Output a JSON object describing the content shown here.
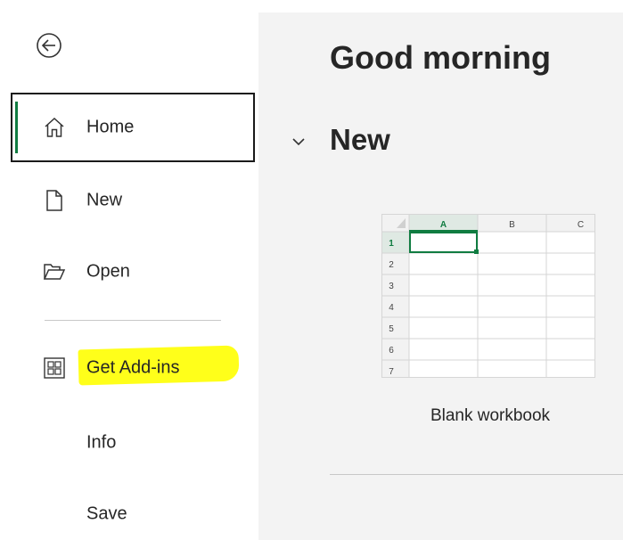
{
  "sidebar": {
    "back": {
      "icon": "back-arrow-icon"
    },
    "items": [
      {
        "label": "Home",
        "icon": "home-icon",
        "selected": true
      },
      {
        "label": "New",
        "icon": "new-document-icon"
      },
      {
        "label": "Open",
        "icon": "open-folder-icon"
      },
      {
        "label": "Get Add-ins",
        "icon": "add-ins-grid-icon",
        "highlighted": true
      },
      {
        "label": "Info"
      },
      {
        "label": "Save"
      }
    ]
  },
  "main": {
    "greeting": "Good morning",
    "section": {
      "title": "New",
      "toggle_icon": "chevron-down-icon",
      "templates": [
        {
          "caption": "Blank workbook",
          "thumbnail": {
            "columns": [
              "A",
              "B",
              "C"
            ],
            "rows": [
              "1",
              "2",
              "3",
              "4",
              "5",
              "6",
              "7"
            ],
            "active_cell": "A1"
          }
        }
      ]
    }
  },
  "colors": {
    "accent": "#107c41",
    "highlight": "#ffff1a",
    "main_background": "#f3f3f3",
    "text": "#262626"
  }
}
